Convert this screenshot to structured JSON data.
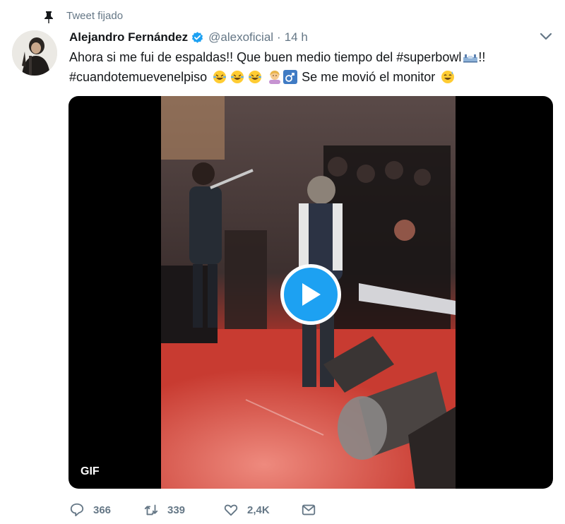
{
  "pinned": {
    "label": "Tweet fijado",
    "icon": "pin-icon"
  },
  "author": {
    "name": "Alejandro Fernández",
    "handle": "@alexoficial",
    "separator": "·",
    "time": "14 h",
    "verified": true,
    "verified_color": "#1da1f2"
  },
  "tweet": {
    "line1_text": "Ahora si me fui de espaldas!! Que buen medio tiempo del #superbowl",
    "line1_suffix": "!!",
    "line2_text": "#cuandotemuevenelpiso",
    "line2_end_text": "Se me movió el monitor",
    "emojis_line1": [
      "stadium-emoji"
    ],
    "emojis_line2": [
      "rofl-emoji",
      "rofl-emoji",
      "rofl-emoji",
      "woman-shrugging-emoji",
      "male-sign-emoji"
    ],
    "emoji_end": "sweat-smile-emoji"
  },
  "media": {
    "type": "GIF",
    "badge": "GIF",
    "play_button_color": "#1da1f2"
  },
  "actions": [
    {
      "name": "reply",
      "icon": "reply-icon",
      "count": "366"
    },
    {
      "name": "retweet",
      "icon": "retweet-icon",
      "count": "339"
    },
    {
      "name": "like",
      "icon": "heart-icon",
      "count": "2,4K"
    },
    {
      "name": "message",
      "icon": "envelope-icon",
      "count": ""
    }
  ],
  "colors": {
    "text": "#14171a",
    "secondary": "#657786",
    "accent": "#1da1f2"
  }
}
